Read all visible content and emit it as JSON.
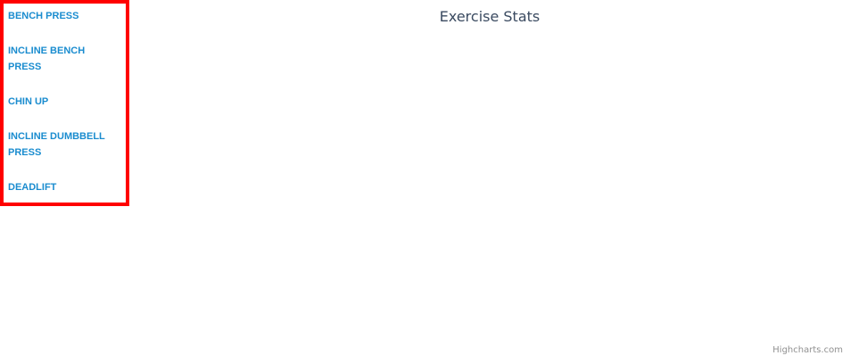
{
  "sidebar": {
    "items": [
      {
        "label": "BENCH PRESS"
      },
      {
        "label": "INCLINE BENCH PRESS"
      },
      {
        "label": "CHIN UP"
      },
      {
        "label": "INCLINE DUMBBELL PRESS"
      },
      {
        "label": "DEADLIFT"
      }
    ],
    "highlight_color": "#ff0000",
    "link_color": "#1a8ccf"
  },
  "chart": {
    "title": "Exercise Stats",
    "credits": "Highcharts.com"
  }
}
